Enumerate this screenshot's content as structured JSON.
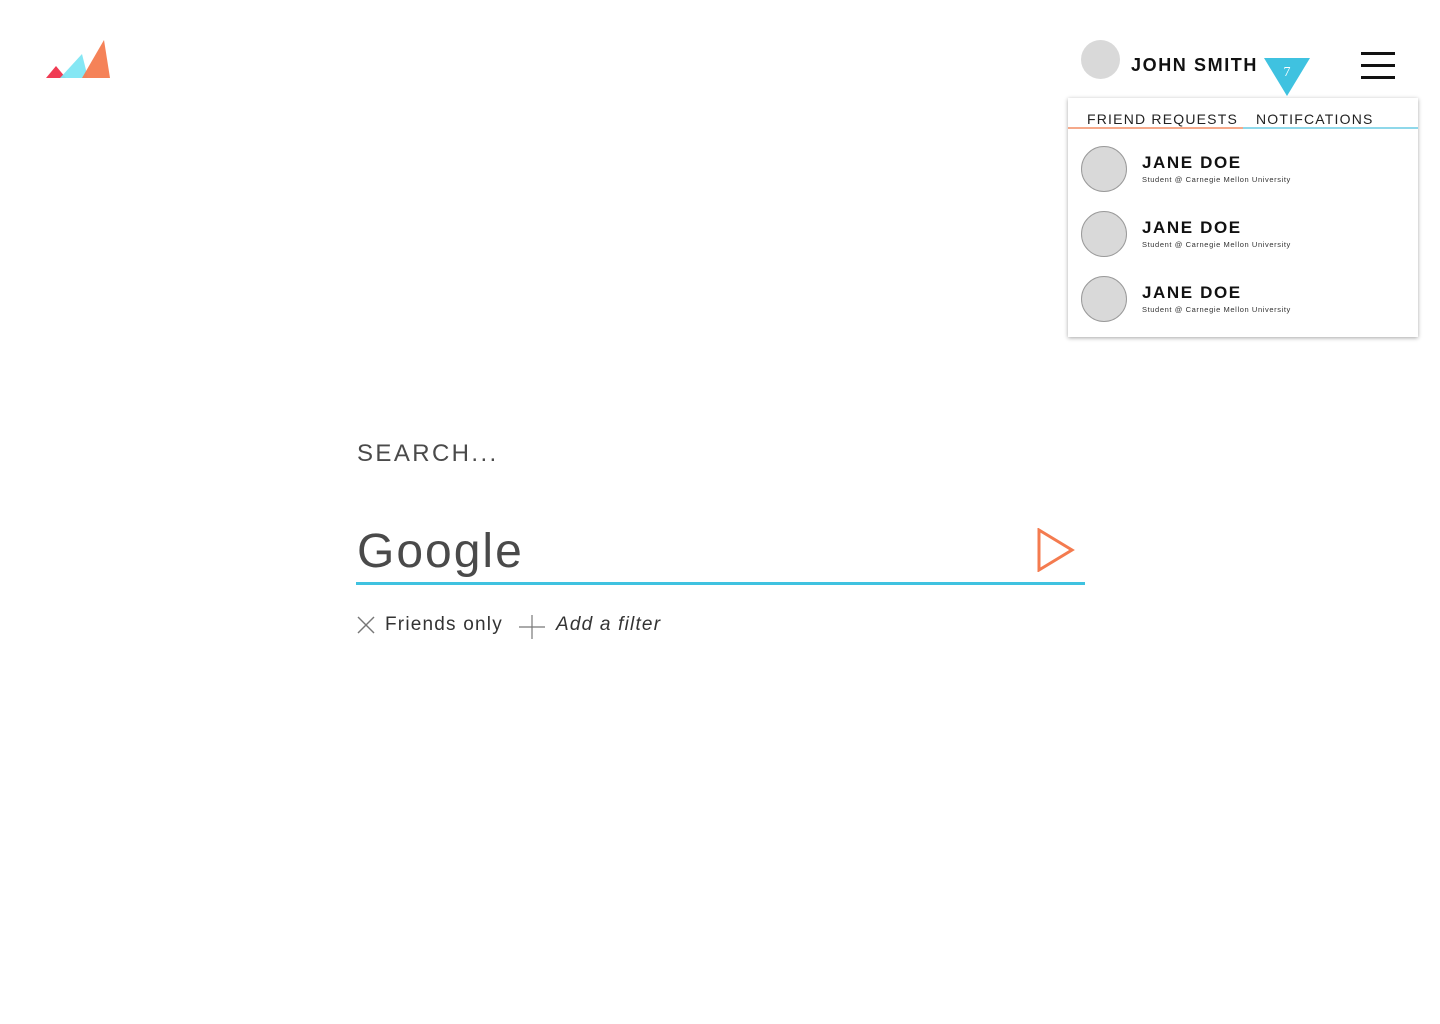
{
  "header": {
    "user_name": "JOHN SMITH",
    "notification_count": "7"
  },
  "dropdown": {
    "tabs": [
      {
        "label": "FRIEND REQUESTS"
      },
      {
        "label": "NOTIFCATIONS"
      }
    ],
    "requests": [
      {
        "name": "JANE DOE",
        "subtitle": "Student @ Carnegie Mellon University"
      },
      {
        "name": "JANE DOE",
        "subtitle": "Student @ Carnegie Mellon University"
      },
      {
        "name": "JANE DOE",
        "subtitle": "Student @ Carnegie Mellon University"
      }
    ]
  },
  "search": {
    "label": "SEARCH...",
    "value": "Google"
  },
  "filters": {
    "active": "Friends only",
    "add": "Add a filter"
  },
  "colors": {
    "accent_blue": "#3fc2e0",
    "accent_orange": "#f47b4f",
    "logo_red": "#f03b53",
    "logo_cyan": "#7ee6f3"
  },
  "icons": {
    "logo": "triangles-logo-icon",
    "notification": "triangle-badge-icon",
    "menu": "hamburger-menu-icon",
    "submit": "play-arrow-icon",
    "remove_filter": "close-icon",
    "add_filter": "plus-icon"
  }
}
